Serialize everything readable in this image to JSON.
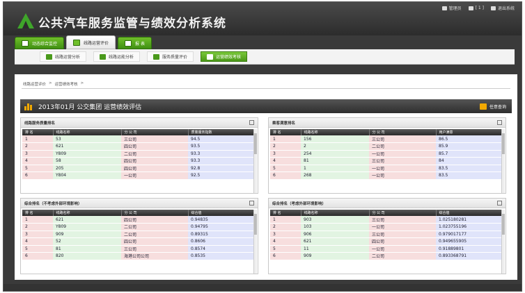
{
  "app": {
    "title": "公共汽车服务监管与绩效分析系统"
  },
  "user_links": [
    "管理员",
    "[ 1 ]",
    "退出系统"
  ],
  "tabs": [
    {
      "label": "动态综合监控"
    },
    {
      "label": "线路运营评价"
    },
    {
      "label": "报    表"
    }
  ],
  "subtabs": [
    {
      "label": "线路运营分析"
    },
    {
      "label": "线路运能分析"
    },
    {
      "label": "服务质量评价"
    },
    {
      "label": "运营绩效考核"
    }
  ],
  "breadcrumb": [
    "线路运营评价",
    ">",
    "运营绩效考核",
    ">"
  ],
  "banner": {
    "title": "2013年01月 公交集团 运营绩效评估",
    "query_label": "任意查询"
  },
  "panels": [
    {
      "title": "线路服务质量排名",
      "columns": [
        "排 名",
        "线路名称",
        "分 公 司",
        "质量服务指数"
      ],
      "rows": [
        [
          "1",
          "53",
          "三公司",
          "94.5"
        ],
        [
          "2",
          "621",
          "四公司",
          "93.5"
        ],
        [
          "3",
          "Y809",
          "二公司",
          "93.3"
        ],
        [
          "4",
          "58",
          "四公司",
          "93.3"
        ],
        [
          "5",
          "205",
          "四公司",
          "92.8"
        ],
        [
          "6",
          "Y804",
          "一公司",
          "92.5"
        ]
      ]
    },
    {
      "title": "乘客满意排名",
      "columns": [
        "排 名",
        "线路名称",
        "分 公 司",
        "用户满意"
      ],
      "rows": [
        [
          "1",
          "156",
          "三公司",
          "86.5"
        ],
        [
          "2",
          "2",
          "二公司",
          "85.9"
        ],
        [
          "3",
          "254",
          "一公司",
          "85.7"
        ],
        [
          "4",
          "81",
          "三公司",
          "84"
        ],
        [
          "5",
          "1",
          "一公司",
          "83.5"
        ],
        [
          "6",
          "268",
          "一公司",
          "83.5"
        ]
      ]
    },
    {
      "title": "综合排名（不考虑外部环境影响）",
      "columns": [
        "排 名",
        "线路名称",
        "分 公 司",
        "综合值"
      ],
      "rows": [
        [
          "1",
          "621",
          "四公司",
          "0.94835"
        ],
        [
          "2",
          "Y809",
          "二公司",
          "0.94795"
        ],
        [
          "3",
          "909",
          "二公司",
          "0.89315"
        ],
        [
          "4",
          "52",
          "四公司",
          "0.8606"
        ],
        [
          "5",
          "81",
          "三公司",
          "0.8574"
        ],
        [
          "6",
          "820",
          "海港公司公司",
          "0.8535"
        ]
      ]
    },
    {
      "title": "综合排名（考虑外部环境影响）",
      "columns": [
        "排 名",
        "线路名称",
        "分 公 司",
        "综合值"
      ],
      "rows": [
        [
          "1",
          "903",
          "三公司",
          "1.025180281"
        ],
        [
          "2",
          "103",
          "一公司",
          "1.023755196"
        ],
        [
          "3",
          "906",
          "三公司",
          "0.979017177"
        ],
        [
          "4",
          "621",
          "四公司",
          "0.949655905"
        ],
        [
          "5",
          "11",
          "一公司",
          "0.91889801"
        ],
        [
          "6",
          "909",
          "二公司",
          "0.893368791"
        ]
      ]
    }
  ]
}
